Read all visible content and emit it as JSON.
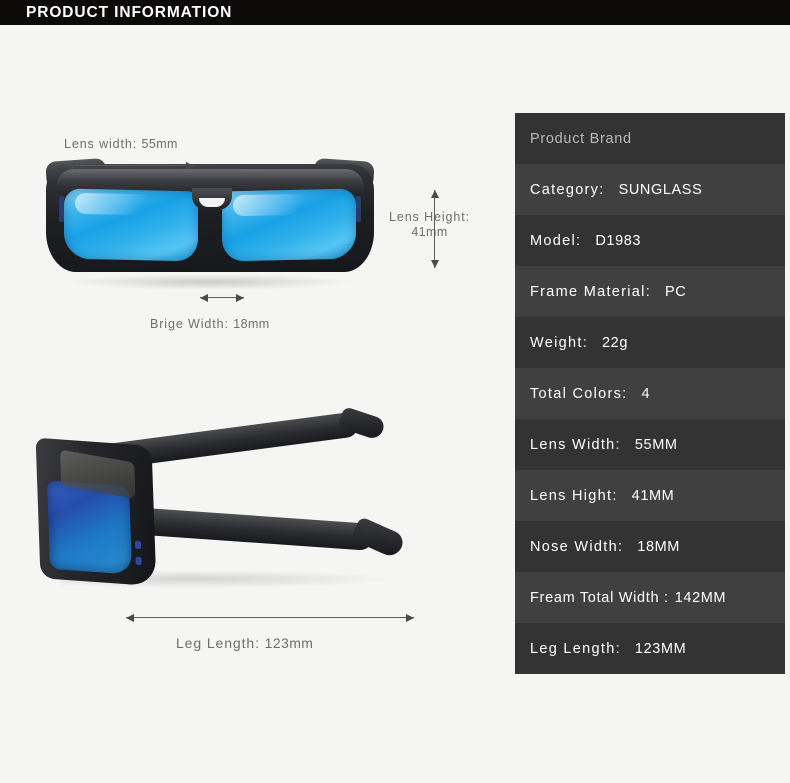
{
  "header": {
    "title": "PRODUCT INFORMATION"
  },
  "annotations": {
    "lens_width": {
      "label": "Lens width:",
      "value": "55mm"
    },
    "lens_height": {
      "label": "Lens Height:",
      "value": "41mm"
    },
    "bridge_width": {
      "label": "Brige Width:",
      "value": "18mm"
    },
    "leg_length": {
      "label": "Leg Length:",
      "value": "123mm"
    }
  },
  "spec_table": {
    "rows": [
      {
        "key": "Product Brand",
        "value": ""
      },
      {
        "key": "Category:",
        "value": "SUNGLASS"
      },
      {
        "key": "Model:",
        "value": "D1983"
      },
      {
        "key": "Frame Material:",
        "value": "PC"
      },
      {
        "key": "Weight:",
        "value": "22g"
      },
      {
        "key": "Total Colors:",
        "value": "4"
      },
      {
        "key": "Lens Width:",
        "value": "55MM"
      },
      {
        "key": "Lens Hight:",
        "value": "41MM"
      },
      {
        "key": "Nose Width:",
        "value": "18MM"
      },
      {
        "key": "Fream Total Width :",
        "value": "142MM"
      },
      {
        "key": "Leg Length:",
        "value": "123MM"
      }
    ]
  },
  "colors": {
    "header_bar": "#0d0a0a",
    "page_background": "#f5f5f4",
    "row_dark": "#333333",
    "row_light": "#404040",
    "text_light": "#ffffff",
    "annotation_text": "#6e6e6e",
    "lens_blue": "#18a1e6",
    "frame_black": "#1e1f23"
  }
}
